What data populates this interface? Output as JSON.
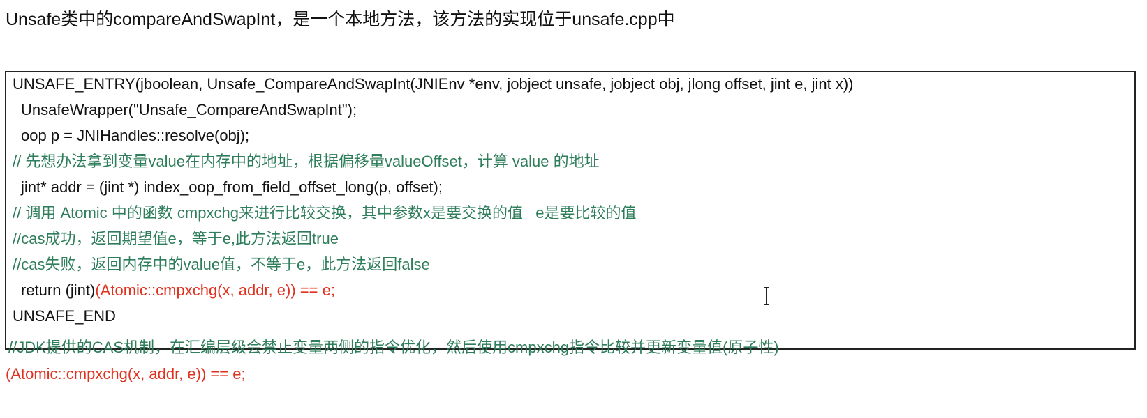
{
  "heading": "Unsafe类中的compareAndSwapInt，是一个本地方法，该方法的实现位于unsafe.cpp中",
  "code": {
    "line1": "UNSAFE_ENTRY(jboolean, Unsafe_CompareAndSwapInt(JNIEnv *env, jobject unsafe, jobject obj, jlong offset, jint e, jint x))",
    "line2": "UnsafeWrapper(\"Unsafe_CompareAndSwapInt\");",
    "line3": "oop p = JNIHandles::resolve(obj);",
    "line4": "// 先想办法拿到变量value在内存中的地址，根据偏移量valueOffset，计算 value 的地址",
    "line5": "jint* addr = (jint *) index_oop_from_field_offset_long(p, offset);",
    "line6": "// 调用 Atomic 中的函数 cmpxchg来进行比较交换，其中参数x是要交换的值   e是要比较的值",
    "line7": "//cas成功，返回期望值e，等于e,此方法返回true",
    "line8": "//cas失败，返回内存中的value值，不等于e，此方法返回false",
    "line9_prefix": "return (jint)",
    "line9_red": "(Atomic::cmpxchg(x, addr, e)) == e;",
    "line10": "UNSAFE_END"
  },
  "footer": {
    "comment": "//JDK提供的CAS机制，在汇编层级会禁止变量两侧的指令优化，然后使用cmpxchg指令比较并更新变量值(原子性)",
    "expression": "(Atomic::cmpxchg(x, addr, e)) == e;"
  },
  "colors": {
    "comment": "#2e7d5b",
    "highlight": "#e0301e"
  },
  "icons": {
    "cursor": "text-cursor-icon"
  }
}
